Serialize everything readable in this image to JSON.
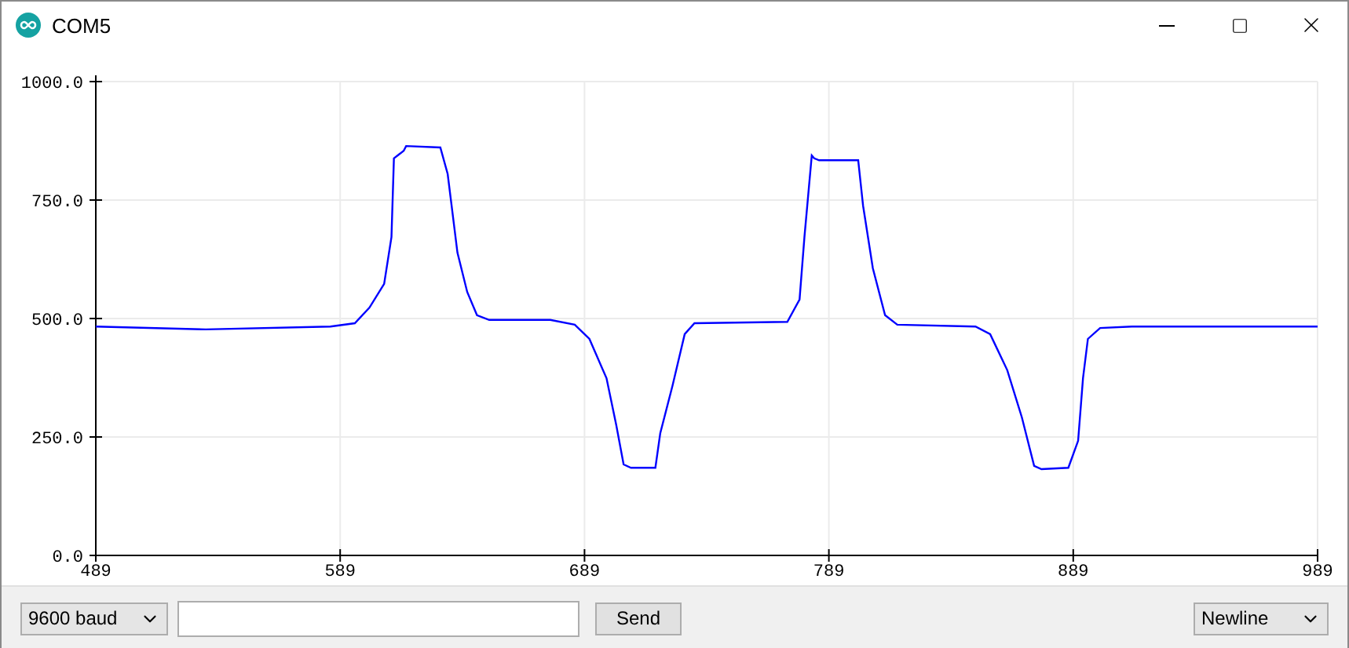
{
  "window": {
    "title": "COM5"
  },
  "plot": {
    "chart_data": {
      "type": "line",
      "x": [
        489,
        534,
        585,
        595,
        601,
        607,
        610,
        611,
        615,
        616,
        630,
        633,
        637,
        641,
        645,
        650,
        675,
        685,
        691,
        698,
        702,
        705,
        708,
        718,
        720,
        725,
        730,
        734,
        772,
        777,
        779,
        782,
        783,
        785,
        801,
        803,
        807,
        812,
        817,
        849,
        855,
        862,
        868,
        873,
        876,
        887,
        891,
        893,
        895,
        900,
        913,
        989
      ],
      "grid": true,
      "series": [
        {
          "color": "#0000ff",
          "values": [
            483,
            477,
            483,
            490,
            523,
            573,
            672,
            838,
            854,
            864,
            861,
            805,
            639,
            556,
            507,
            497,
            497,
            487,
            457,
            374,
            275,
            192,
            185,
            185,
            258,
            358,
            467,
            490,
            493,
            540,
            672,
            844,
            838,
            834,
            834,
            738,
            606,
            507,
            487,
            483,
            467,
            391,
            291,
            189,
            182,
            185,
            242,
            374,
            457,
            480,
            483,
            483
          ]
        }
      ],
      "xlim": [
        489,
        989
      ],
      "ylim": [
        0,
        1000
      ],
      "xticks": [
        489,
        589,
        689,
        789,
        889,
        989
      ],
      "yticks": [
        {
          "value": 0,
          "label": "0.0"
        },
        {
          "value": 250,
          "label": "250.0"
        },
        {
          "value": 500,
          "label": "500.0"
        },
        {
          "value": 750,
          "label": "750.0"
        },
        {
          "value": 1000,
          "label": "1000.0"
        }
      ]
    }
  },
  "bottom_bar": {
    "baud": "9600 baud",
    "send": "Send",
    "line_ending": "Newline"
  }
}
